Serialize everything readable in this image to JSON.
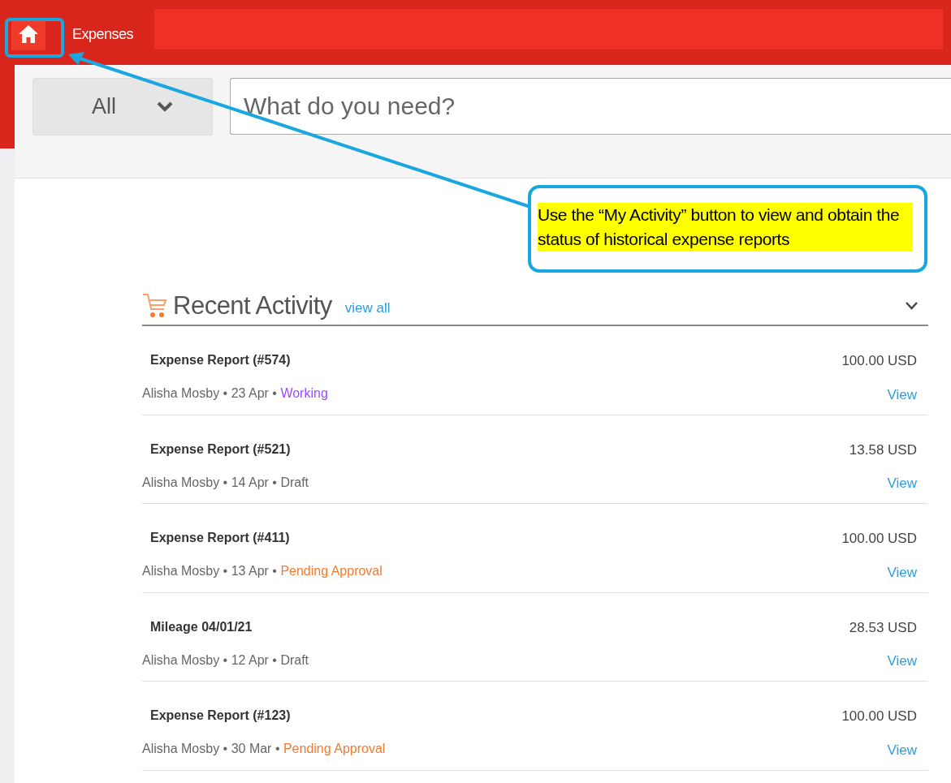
{
  "header": {
    "title": "Expenses"
  },
  "search": {
    "category": "All",
    "placeholder": "What do you need?"
  },
  "callout": {
    "text": "Use the “My Activity” button to view and obtain the status of historical expense reports"
  },
  "recent_activity": {
    "title": "Recent Activity",
    "view_all": "view all",
    "expanded": true,
    "items": [
      {
        "title": "Expense Report (#574)",
        "meta": "Alisha Mosby • 23 Apr • ",
        "status": "Working",
        "color": "#9b4dff",
        "amount": "100.00 USD",
        "link": "View"
      },
      {
        "title": "Expense Report (#521)",
        "meta": "Alisha Mosby • 14 Apr • ",
        "status": "Draft",
        "color": "#666666",
        "amount": "13.58 USD",
        "link": "View"
      },
      {
        "title": "Expense Report (#411)",
        "meta": "Alisha Mosby • 13 Apr • ",
        "status": "Pending Approval",
        "color": "#f47a30",
        "amount": "100.00 USD",
        "link": "View"
      },
      {
        "title": "Mileage 04/01/21",
        "meta": "Alisha Mosby • 12 Apr • ",
        "status": "Draft",
        "color": "#666666",
        "amount": "28.53 USD",
        "link": "View"
      },
      {
        "title": "Expense Report (#123)",
        "meta": "Alisha Mosby • 30 Mar • ",
        "status": "Pending Approval",
        "color": "#f47a30",
        "amount": "100.00 USD",
        "link": "View"
      }
    ]
  }
}
